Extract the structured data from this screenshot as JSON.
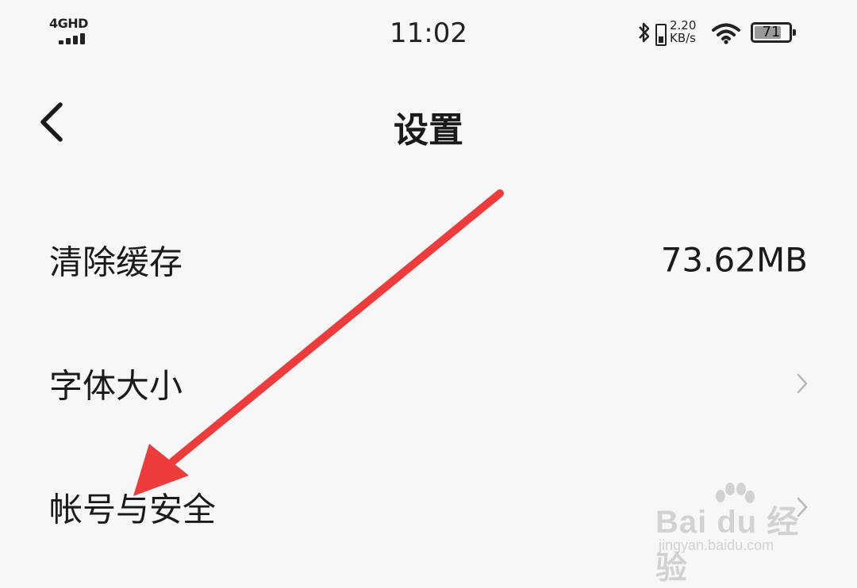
{
  "status_bar": {
    "network": "4GHD",
    "time": "11:02",
    "net_speed_value": "2.20",
    "net_speed_unit": "KB/s",
    "battery_level": "71"
  },
  "nav": {
    "title": "设置"
  },
  "settings": {
    "items": [
      {
        "label": "清除缓存",
        "value": "73.62MB"
      },
      {
        "label": "字体大小"
      },
      {
        "label": "帐号与安全"
      }
    ]
  },
  "annotation": {
    "arrow_color": "#ee3b3b"
  },
  "watermark": {
    "brand": "Bai du 经验",
    "url": "jingyan.baidu.com"
  },
  "colors": {
    "background": "#f7f7f7",
    "text": "#1a1a1a",
    "chevron": "#b8b8b8"
  }
}
